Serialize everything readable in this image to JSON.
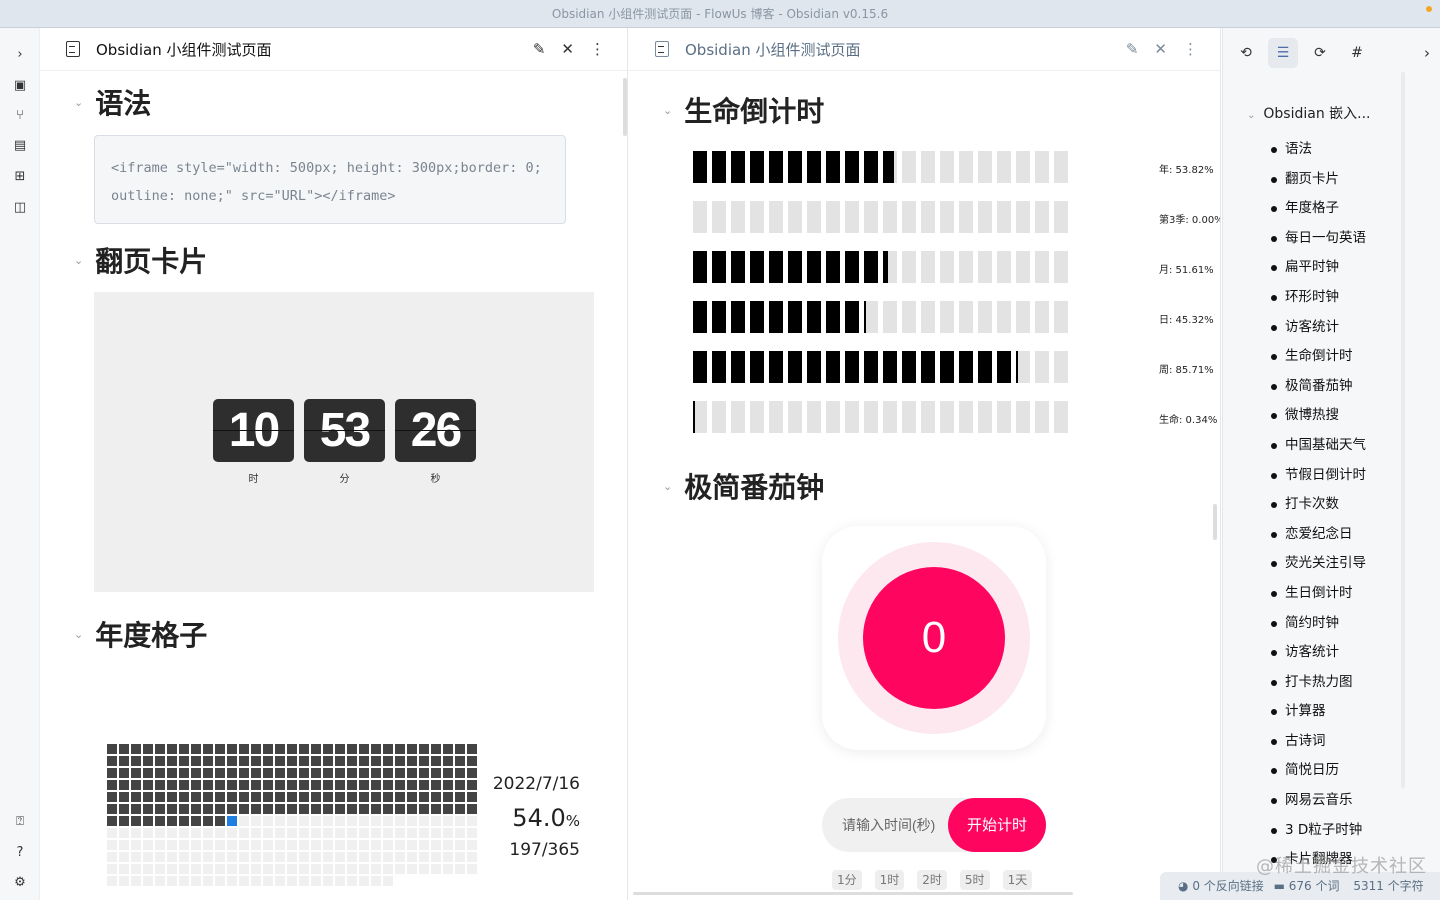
{
  "window": {
    "title": "Obsidian 小组件测试页面 - FlowUs 博客 - Obsidian v0.15.6"
  },
  "ribbon": {
    "icons": [
      "chevron-right-icon",
      "file-search-icon",
      "graph-icon",
      "slides-icon",
      "grid-icon",
      "sidebar-icon",
      "help-vault-icon",
      "help-icon",
      "settings-icon"
    ]
  },
  "left_pane": {
    "tab_title": "Obsidian 小组件测试页面",
    "headings": [
      "语法",
      "翻页卡片",
      "年度格子"
    ],
    "code": "<iframe style=\"width: 500px; height: 300px;border: 0; outline: none;\" src=\"URL\"></iframe>",
    "flip": {
      "hour": "10",
      "minute": "53",
      "second": "26",
      "hour_label": "时",
      "minute_label": "分",
      "second_label": "秒"
    },
    "year": {
      "date": "2022/7/16",
      "percent": "54.0",
      "percent_unit": "%",
      "progress": "197/365",
      "days_passed": 197,
      "days_total": 365
    }
  },
  "mid_pane": {
    "tab_title": "Obsidian 小组件测试页面",
    "headings": [
      "生命倒计时",
      "极简番茄钟"
    ],
    "life": [
      {
        "label": "年: 53.82%",
        "fraction": 0.5382
      },
      {
        "label": "第3季: 0.00%",
        "fraction": 0.0
      },
      {
        "label": "月: 51.61%",
        "fraction": 0.5161
      },
      {
        "label": "日: 45.32%",
        "fraction": 0.4532
      },
      {
        "label": "周: 85.71%",
        "fraction": 0.8571
      },
      {
        "label": "生命: 0.34%",
        "fraction": 0.0034
      }
    ],
    "tomato": {
      "count": "0",
      "placeholder": "请输入时间(秒)",
      "start_label": "开始计时",
      "chips": [
        "1分",
        "1时",
        "2时",
        "5时",
        "1天"
      ]
    }
  },
  "right_pane": {
    "tab_icons": [
      "backlink-icon",
      "outline-icon",
      "outgoing-link-icon",
      "tag-icon"
    ],
    "outline_root": "Obsidian 嵌入...",
    "outline_items": [
      "语法",
      "翻页卡片",
      "年度格子",
      "每日一句英语",
      "扁平时钟",
      "环形时钟",
      "访客统计",
      "生命倒计时",
      "极简番茄钟",
      "微博热搜",
      "中国基础天气",
      "节假日倒计时",
      "打卡次数",
      "恋爱纪念日",
      "荧光关注引导",
      "生日倒计时",
      "简约时钟",
      "访客统计",
      "打卡热力图",
      "计算器",
      "古诗词",
      "简悦日历",
      "网易云音乐",
      "3 D粒子时钟",
      "卡片翻牌器"
    ]
  },
  "status_bar": {
    "backlinks": "0 个反向链接",
    "words": "676 个词",
    "chars": "5311 个字符"
  },
  "watermark": "@稀土掘金技术社区"
}
